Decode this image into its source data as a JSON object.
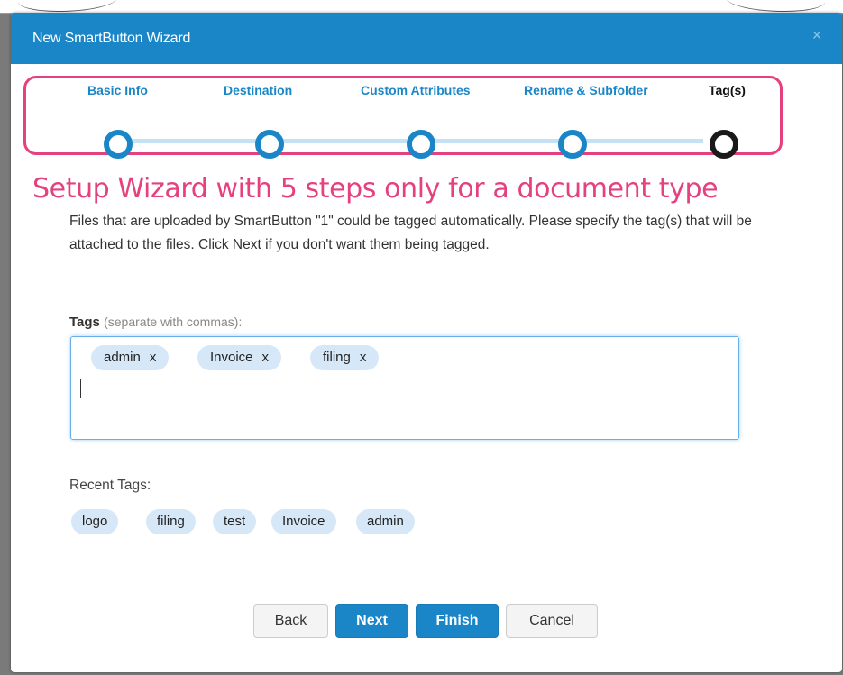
{
  "window": {
    "title": "New SmartButton Wizard",
    "close_label": "×"
  },
  "stepper": {
    "steps": [
      {
        "label": "Basic Info",
        "state": "completed"
      },
      {
        "label": "Destination",
        "state": "completed"
      },
      {
        "label": "Custom Attributes",
        "state": "completed"
      },
      {
        "label": "Rename & Subfolder",
        "state": "completed"
      },
      {
        "label": "Tag(s)",
        "state": "active"
      }
    ]
  },
  "annotation": {
    "text": "Setup Wizard with 5 steps only for a document type",
    "color": "#e6417f"
  },
  "description": "Files that are uploaded by SmartButton \"1\" could be tagged automatically. Please specify the tag(s) that will be attached to the files. Click Next if you don't want them being tagged.",
  "tags": {
    "label": "Tags",
    "hint": "(separate with commas):",
    "remove_label": "x",
    "items": [
      "admin",
      "Invoice",
      "filing"
    ]
  },
  "recent_tags": {
    "label": "Recent Tags:",
    "items": [
      "logo",
      "filing",
      "test",
      "Invoice",
      "admin"
    ]
  },
  "footer": {
    "back_label": "Back",
    "next_label": "Next",
    "finish_label": "Finish",
    "cancel_label": "Cancel"
  },
  "colors": {
    "primary": "#1a86c8",
    "chip": "#d6e8f8",
    "highlight": "#e6417f"
  }
}
